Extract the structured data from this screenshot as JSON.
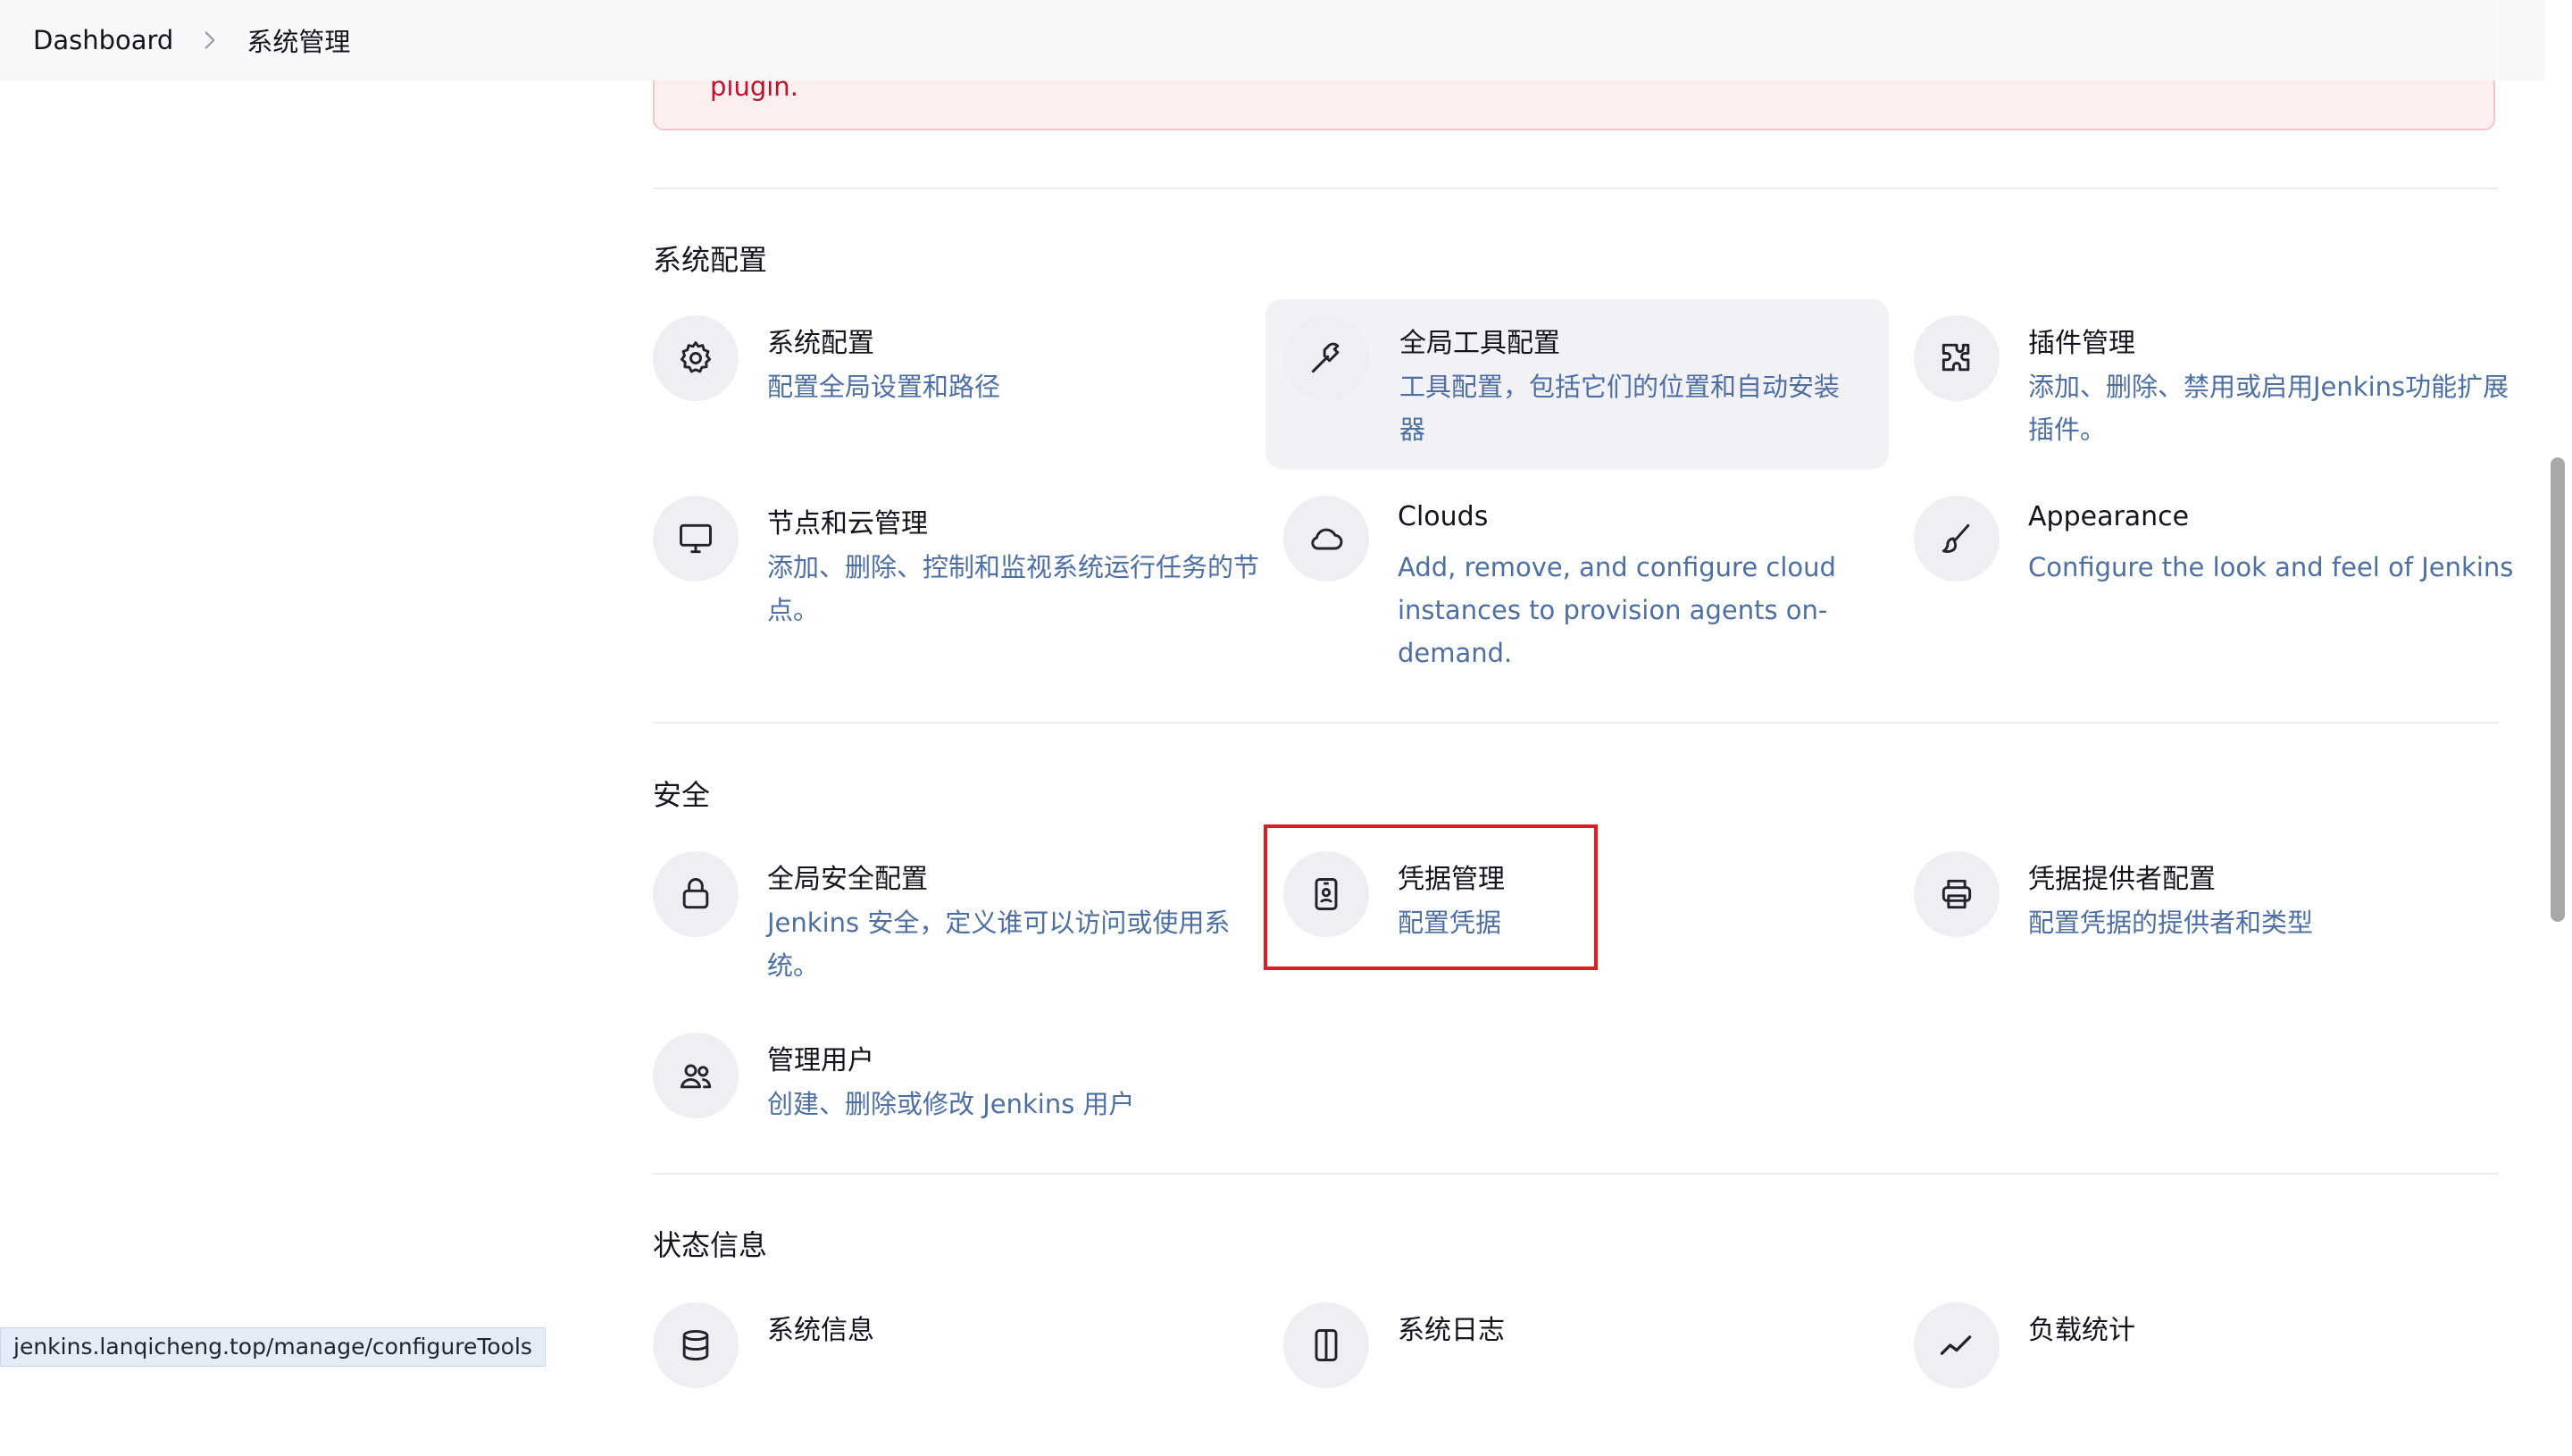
{
  "breadcrumb": {
    "items": [
      "Dashboard",
      "系统管理"
    ]
  },
  "alert": {
    "text": "plugin."
  },
  "sections": {
    "system_config": {
      "title": "系统配置",
      "items": [
        {
          "title": "系统配置",
          "desc": "配置全局设置和路径",
          "icon": "gear-icon"
        },
        {
          "title": "全局工具配置",
          "desc": "工具配置，包括它们的位置和自动安装器",
          "icon": "hammer-icon"
        },
        {
          "title": "插件管理",
          "desc": "添加、删除、禁用或启用Jenkins功能扩展插件。",
          "icon": "puzzle-icon"
        },
        {
          "title": "节点和云管理",
          "desc": "添加、删除、控制和监视系统运行任务的节点。",
          "icon": "monitor-icon"
        },
        {
          "title": "Clouds",
          "desc": "Add, remove, and configure cloud instances to provision agents on-demand.",
          "icon": "cloud-icon"
        },
        {
          "title": "Appearance",
          "desc": "Configure the look and feel of Jenkins",
          "icon": "brush-icon"
        }
      ]
    },
    "security": {
      "title": "安全",
      "items": [
        {
          "title": "全局安全配置",
          "desc": "Jenkins 安全，定义谁可以访问或使用系统。",
          "icon": "lock-icon"
        },
        {
          "title": "凭据管理",
          "desc": "配置凭据",
          "icon": "id-card-icon"
        },
        {
          "title": "凭据提供者配置",
          "desc": "配置凭据的提供者和类型",
          "icon": "printer-icon"
        },
        {
          "title": "管理用户",
          "desc": "创建、删除或修改 Jenkins 用户",
          "icon": "users-icon"
        }
      ]
    },
    "status": {
      "title": "状态信息",
      "items": [
        {
          "title": "系统信息",
          "desc": "",
          "icon": "database-icon"
        },
        {
          "title": "系统日志",
          "desc": "",
          "icon": "log-icon"
        },
        {
          "title": "负载统计",
          "desc": "",
          "icon": "chart-line-icon"
        }
      ]
    }
  },
  "status_bar": {
    "url": "jenkins.lanqicheng.top/manage/configureTools"
  },
  "colors": {
    "link_desc": "#4d6fa3",
    "alert_text": "#c0112b",
    "highlight": "#e01b24"
  }
}
